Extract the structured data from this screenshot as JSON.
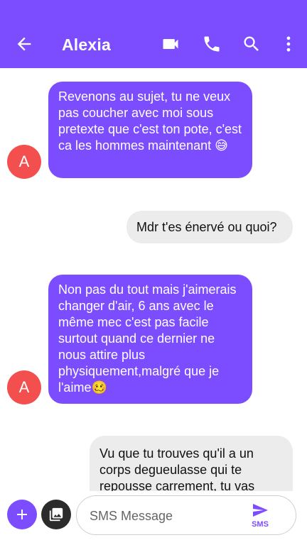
{
  "header": {
    "contact_name": "Alexia",
    "icons": [
      "back-arrow-icon",
      "video-call-icon",
      "phone-icon",
      "search-icon",
      "more-vert-icon"
    ],
    "color": "#7c4dff"
  },
  "messages": [
    {
      "direction": "incoming",
      "avatar": "A",
      "text": "Revenons au sujet, tu ne veux pas coucher avec moi sous pretexte que c'est ton pote, c'est ca les hommes maintenant 😅"
    },
    {
      "direction": "outgoing",
      "text": "Mdr t'es énervé ou quoi?"
    },
    {
      "direction": "incoming",
      "avatar": "A",
      "text": "Non pas du tout mais j'aimerais changer d'air, 6 ans avec le même mec c'est pas facile surtout quand ce dernier ne nous attire plus physiquement,malgré que je l'aime🥴"
    },
    {
      "direction": "outgoing",
      "text": "Vu que tu trouves qu'il a un corps degueulasse qui te repousse carrement, tu vas"
    }
  ],
  "composer": {
    "placeholder": "SMS Message",
    "send_label": "SMS",
    "icons": [
      "add-icon",
      "gallery-icon",
      "send-icon"
    ]
  },
  "colors": {
    "accent": "#7c4dff",
    "avatar": "#f44f4f",
    "outgoing_bubble": "#ececec"
  }
}
